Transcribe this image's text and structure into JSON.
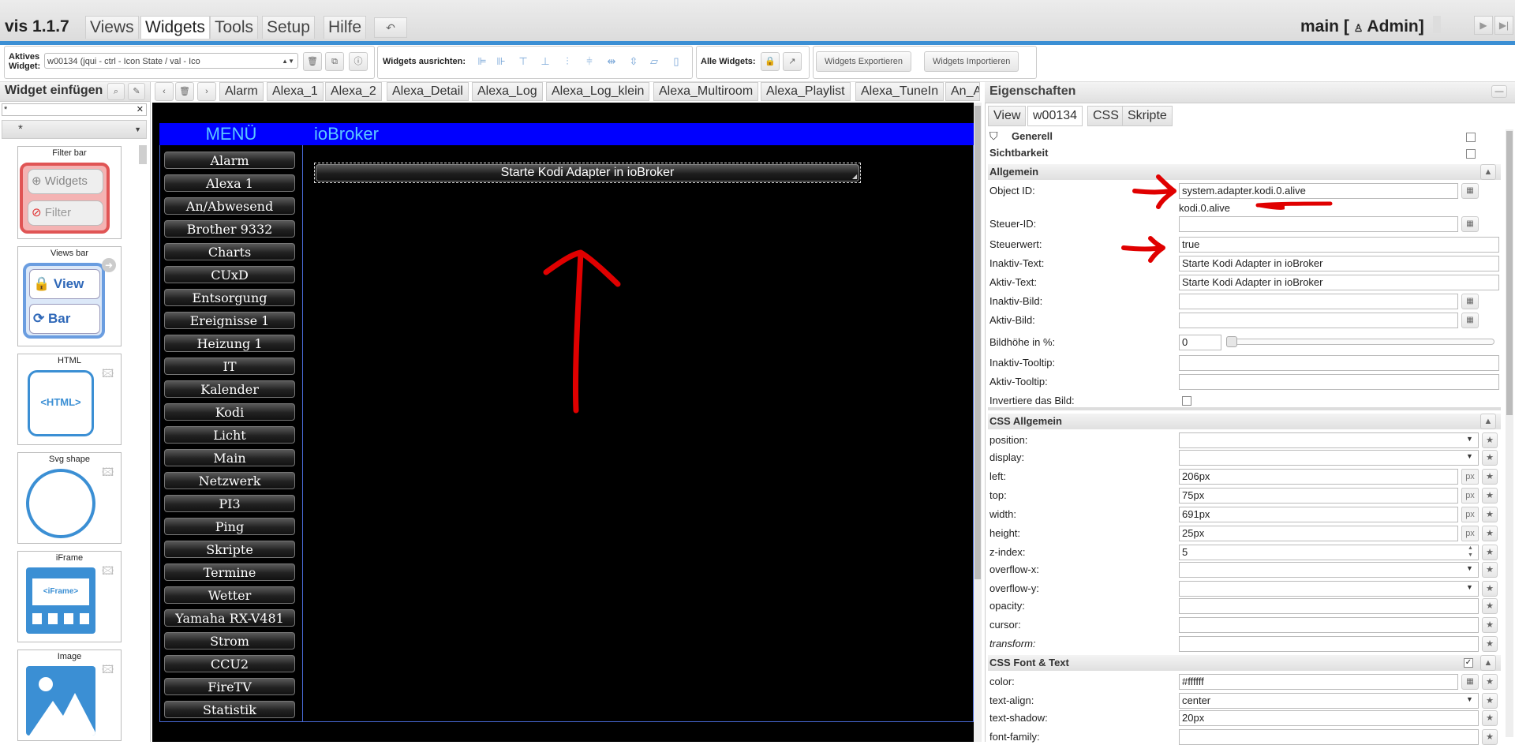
{
  "app": {
    "title": "vis 1.1.7",
    "project": "main [ ",
    "user": " Admin]"
  },
  "menu_tabs": [
    "Views",
    "Widgets",
    "Tools",
    "Setup",
    "Hilfe"
  ],
  "toolbar": {
    "active_widget_label_1": "Aktives",
    "active_widget_label_2": "Widget:",
    "active_widget_value": "w00134 (jqui - ctrl - Icon State / val - Ico",
    "align_label": "Widgets ausrichten:",
    "all_widgets_label": "Alle Widgets:",
    "export_btn": "Widgets Exportieren",
    "import_btn": "Widgets Importieren"
  },
  "palette": {
    "title": "Widget einfügen",
    "filter_value": "*",
    "select_value": "*",
    "cards": [
      {
        "title": "Filter bar",
        "items": [
          "Widgets",
          "Filter"
        ]
      },
      {
        "title": "Views bar",
        "items": [
          "View",
          "Bar"
        ]
      },
      {
        "title": "HTML",
        "items": [
          "<HTML>"
        ]
      },
      {
        "title": "Svg shape",
        "items": []
      },
      {
        "title": "iFrame",
        "items": [
          "<iFrame>"
        ]
      },
      {
        "title": "Image",
        "items": []
      }
    ]
  },
  "view_tabs": [
    "Alarm",
    "Alexa_1",
    "Alexa_2",
    "Alexa_Detail",
    "Alexa_Log",
    "Alexa_Log_klein",
    "Alexa_Multiroom",
    "Alexa_Playlist",
    "Alexa_TuneIn",
    "An_A"
  ],
  "canvas": {
    "menu_header": "MENÜ",
    "header_title": "ioBroker",
    "menu_items": [
      "Alarm",
      "Alexa 1",
      "An/Abwesend",
      "Brother 9332",
      "Charts",
      "CUxD",
      "Entsorgung",
      "Ereignisse 1",
      "Heizung 1",
      "IT",
      "Kalender",
      "Kodi",
      "Licht",
      "Main",
      "Netzwerk",
      "PI3",
      "Ping",
      "Skripte",
      "Termine",
      "Wetter",
      "Yamaha RX-V481",
      "Strom",
      "CCU2",
      "FireTV",
      "Statistik"
    ],
    "widget_button": "Starte Kodi Adapter in ioBroker"
  },
  "props": {
    "title": "Eigenschaften",
    "tabs": [
      "View",
      "w00134",
      "CSS",
      "Skripte"
    ],
    "sections": {
      "generell": "Generell",
      "sichtbarkeit": "Sichtbarkeit",
      "allgemein": "Allgemein",
      "css_allgemein": "CSS Allgemein",
      "css_font": "CSS Font & Text"
    },
    "allgemein": [
      {
        "label": "Object ID:",
        "value": "system.adapter.kodi.0.alive",
        "sub": "kodi.0.alive"
      },
      {
        "label": "Steuer-ID:",
        "value": ""
      },
      {
        "label": "Steuerwert:",
        "value": "true"
      },
      {
        "label": "Inaktiv-Text:",
        "value": "Starte Kodi Adapter in ioBroker"
      },
      {
        "label": "Aktiv-Text:",
        "value": "Starte Kodi Adapter in ioBroker"
      },
      {
        "label": "Inaktiv-Bild:",
        "value": ""
      },
      {
        "label": "Aktiv-Bild:",
        "value": ""
      },
      {
        "label": "Bildhöhe in %:",
        "value": "0"
      },
      {
        "label": "Inaktiv-Tooltip:",
        "value": ""
      },
      {
        "label": "Aktiv-Tooltip:",
        "value": ""
      },
      {
        "label": "Invertiere das Bild:",
        "value": ""
      }
    ],
    "css_allgemein": [
      {
        "label": "position:",
        "value": ""
      },
      {
        "label": "display:",
        "value": ""
      },
      {
        "label": "left:",
        "value": "206px"
      },
      {
        "label": "top:",
        "value": "75px"
      },
      {
        "label": "width:",
        "value": "691px"
      },
      {
        "label": "height:",
        "value": "25px"
      },
      {
        "label": "z-index:",
        "value": "5"
      },
      {
        "label": "overflow-x:",
        "value": ""
      },
      {
        "label": "overflow-y:",
        "value": ""
      },
      {
        "label": "opacity:",
        "value": ""
      },
      {
        "label": "cursor:",
        "value": ""
      },
      {
        "label": "transform:",
        "value": ""
      }
    ],
    "css_font": [
      {
        "label": "color:",
        "value": "#ffffff"
      },
      {
        "label": "text-align:",
        "value": "center"
      },
      {
        "label": "text-shadow:",
        "value": "20px"
      },
      {
        "label": "font-family:",
        "value": ""
      }
    ],
    "px_unit": "px"
  },
  "colors": {
    "accent": "#3b8fd4",
    "canvas_header": "#0000ff",
    "menu_header_text": "#5cc8ff",
    "annotation": "#e00000"
  }
}
